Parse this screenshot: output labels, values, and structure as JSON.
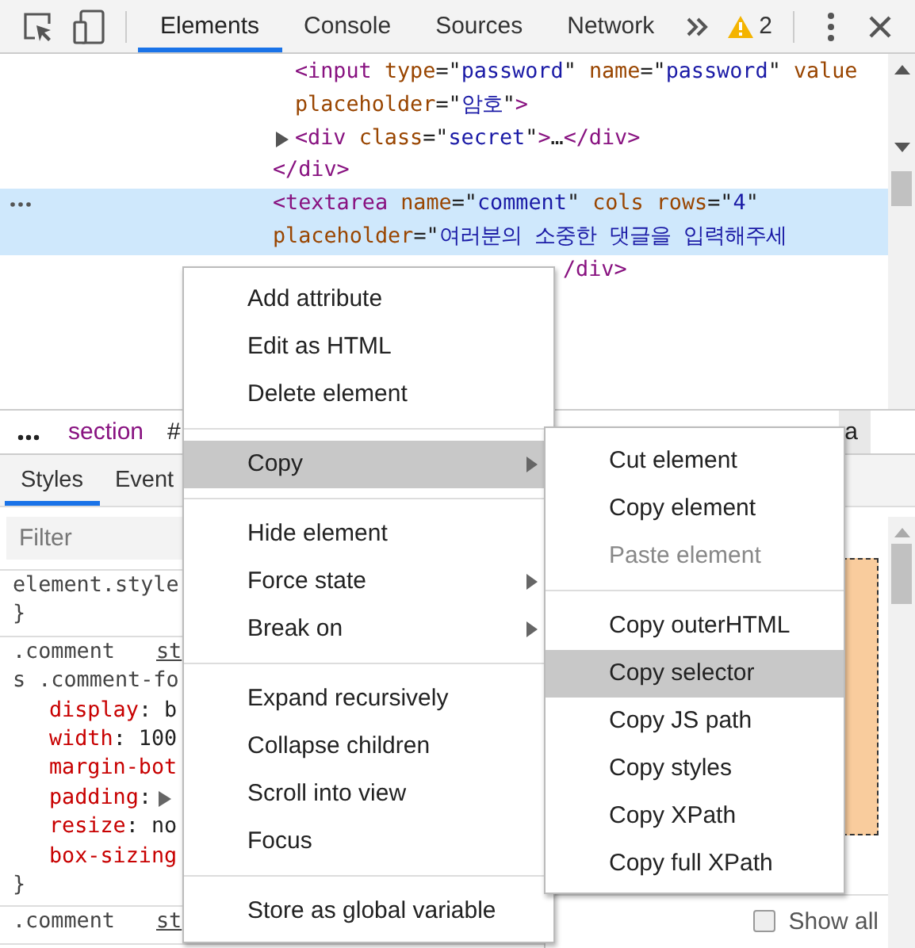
{
  "toolbar": {
    "tabs": [
      {
        "label": "Elements",
        "selected": true
      },
      {
        "label": "Console",
        "selected": false
      },
      {
        "label": "Sources",
        "selected": false
      },
      {
        "label": "Network",
        "selected": false
      }
    ],
    "warning_count": "2"
  },
  "dom_tree": [
    {
      "kind": "node",
      "selected": false,
      "children": [
        {
          "kind": "node",
          "selected": false,
          "expandable": false,
          "lines": [
            [
              {
                "kind": "tag",
                "text": "<input "
              },
              {
                "kind": "attr",
                "text": "type"
              },
              {
                "kind": "text",
                "text": "=\""
              },
              {
                "kind": "value",
                "text": "password"
              },
              {
                "kind": "text",
                "text": "\" "
              },
              {
                "kind": "attr",
                "text": "name"
              },
              {
                "kind": "text",
                "text": "=\""
              },
              {
                "kind": "value",
                "text": "password"
              },
              {
                "kind": "text",
                "text": "\" "
              },
              {
                "kind": "attr",
                "text": "value"
              }
            ],
            [
              {
                "kind": "attr",
                "text": "placeholder"
              },
              {
                "kind": "text",
                "text": "=\""
              },
              {
                "kind": "value",
                "text": "암호"
              },
              {
                "kind": "text",
                "text": "\""
              },
              {
                "kind": "tag",
                "text": ">"
              }
            ]
          ]
        },
        {
          "kind": "node",
          "selected": false,
          "expandable": true,
          "lines": [
            [
              {
                "kind": "tag",
                "text": "<div "
              },
              {
                "kind": "attr",
                "text": "class"
              },
              {
                "kind": "text",
                "text": "=\""
              },
              {
                "kind": "value",
                "text": "secret"
              },
              {
                "kind": "text",
                "text": "\""
              },
              {
                "kind": "tag",
                "text": ">"
              },
              {
                "kind": "text",
                "text": "…"
              },
              {
                "kind": "tag",
                "text": "</div>"
              }
            ]
          ]
        }
      ],
      "closing": [
        {
          "kind": "tag",
          "text": "</div>"
        }
      ]
    },
    {
      "kind": "node",
      "selected": true,
      "expandable": false,
      "lines": [
        [
          {
            "kind": "tag",
            "text": "<textarea "
          },
          {
            "kind": "attr",
            "text": "name"
          },
          {
            "kind": "text",
            "text": "=\""
          },
          {
            "kind": "value",
            "text": "comment"
          },
          {
            "kind": "text",
            "text": "\" "
          },
          {
            "kind": "attr",
            "text": "cols rows"
          },
          {
            "kind": "text",
            "text": "=\""
          },
          {
            "kind": "value",
            "text": "4"
          },
          {
            "kind": "text",
            "text": "\""
          }
        ],
        [
          {
            "kind": "attr",
            "text": "placeholder"
          },
          {
            "kind": "text",
            "text": "=\""
          },
          {
            "kind": "value",
            "text": "여러분의 소중한 댓글을 입력해주세"
          }
        ]
      ]
    },
    {
      "kind": "covered",
      "selected": false,
      "lines": [
        [
          {
            "kind": "tag",
            "text": "/div>"
          }
        ]
      ]
    }
  ],
  "breadcrumbs": [
    {
      "label": "section",
      "selected": false
    },
    {
      "label": "#",
      "selected": false
    },
    {
      "label": "a",
      "selected": true
    }
  ],
  "styles": {
    "tabs": [
      {
        "label": "Styles",
        "selected": true
      },
      {
        "label": "Event",
        "selected": false
      }
    ],
    "filter": {
      "placeholder": "Filter"
    },
    "rules": [
      {
        "selector": [
          "element.style"
        ],
        "closing": "}"
      },
      {
        "selector": [
          ".comment",
          "s .comment-fo"
        ],
        "source": "st",
        "declarations": [
          {
            "property": "display",
            "value": ": b"
          },
          {
            "property": "width",
            "value": ": 100"
          },
          {
            "property": "margin-bot"
          },
          {
            "property": "padding",
            "value": ":",
            "expandable": true
          },
          {
            "property": "resize",
            "value": ": no"
          },
          {
            "property": "box-sizing"
          }
        ],
        "closing": "}"
      },
      {
        "selector": [
          ".comment"
        ],
        "source": "st"
      }
    ]
  },
  "computed": {
    "show_all": {
      "label": "Show all",
      "checked": false
    }
  },
  "context_menu": [
    {
      "kind": "item",
      "label": "Add attribute",
      "submenu": false,
      "selected": false,
      "disabled": false
    },
    {
      "kind": "item",
      "label": "Edit as HTML",
      "submenu": false,
      "selected": false,
      "disabled": false
    },
    {
      "kind": "item",
      "label": "Delete element",
      "submenu": false,
      "selected": false,
      "disabled": false
    },
    {
      "kind": "separator"
    },
    {
      "kind": "item",
      "label": "Copy",
      "submenu": true,
      "selected": true,
      "disabled": false
    },
    {
      "kind": "separator"
    },
    {
      "kind": "item",
      "label": "Hide element",
      "submenu": false,
      "selected": false,
      "disabled": false
    },
    {
      "kind": "item",
      "label": "Force state",
      "submenu": true,
      "selected": false,
      "disabled": false
    },
    {
      "kind": "item",
      "label": "Break on",
      "submenu": true,
      "selected": false,
      "disabled": false
    },
    {
      "kind": "separator"
    },
    {
      "kind": "item",
      "label": "Expand recursively",
      "submenu": false,
      "selected": false,
      "disabled": false
    },
    {
      "kind": "item",
      "label": "Collapse children",
      "submenu": false,
      "selected": false,
      "disabled": false
    },
    {
      "kind": "item",
      "label": "Scroll into view",
      "submenu": false,
      "selected": false,
      "disabled": false
    },
    {
      "kind": "item",
      "label": "Focus",
      "submenu": false,
      "selected": false,
      "disabled": false
    },
    {
      "kind": "separator"
    },
    {
      "kind": "item",
      "label": "Store as global variable",
      "submenu": false,
      "selected": false,
      "disabled": false
    }
  ],
  "copy_submenu": [
    {
      "kind": "item",
      "label": "Cut element",
      "submenu": false,
      "selected": false,
      "disabled": false
    },
    {
      "kind": "item",
      "label": "Copy element",
      "submenu": false,
      "selected": false,
      "disabled": false
    },
    {
      "kind": "item",
      "label": "Paste element",
      "submenu": false,
      "selected": false,
      "disabled": true
    },
    {
      "kind": "separator"
    },
    {
      "kind": "item",
      "label": "Copy outerHTML",
      "submenu": false,
      "selected": false,
      "disabled": false
    },
    {
      "kind": "item",
      "label": "Copy selector",
      "submenu": false,
      "selected": true,
      "disabled": false
    },
    {
      "kind": "item",
      "label": "Copy JS path",
      "submenu": false,
      "selected": false,
      "disabled": false
    },
    {
      "kind": "item",
      "label": "Copy styles",
      "submenu": false,
      "selected": false,
      "disabled": false
    },
    {
      "kind": "item",
      "label": "Copy XPath",
      "submenu": false,
      "selected": false,
      "disabled": false
    },
    {
      "kind": "item",
      "label": "Copy full XPath",
      "submenu": false,
      "selected": false,
      "disabled": false
    }
  ]
}
